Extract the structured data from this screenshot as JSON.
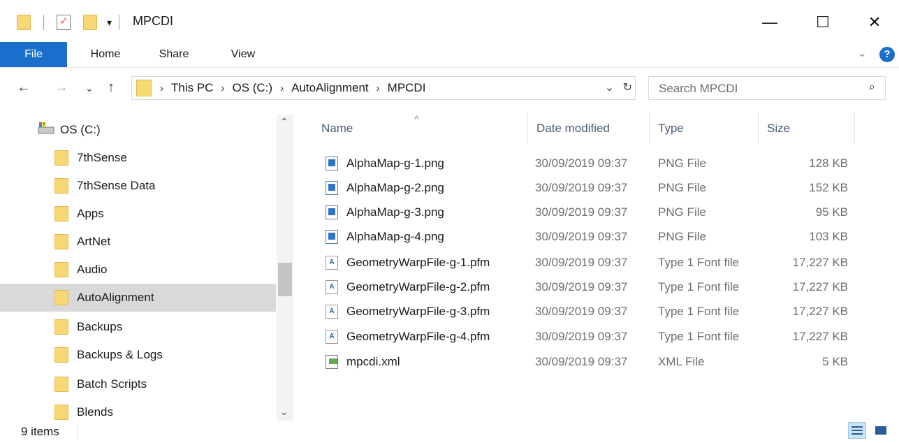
{
  "window": {
    "title": "MPCDI",
    "qa_dropdown_glyph": "▾",
    "minimize": "—",
    "maximize": "☐",
    "close": "✕"
  },
  "ribbon": {
    "tabs": [
      "File",
      "Home",
      "Share",
      "View"
    ],
    "expand_glyph": "⌄",
    "help_glyph": "?",
    "accent_color": "#1a6fcc"
  },
  "nav": {
    "back": "←",
    "forward": "→",
    "recent": "⌄",
    "up": "↑"
  },
  "address": {
    "crumbs": [
      "This PC",
      "OS (C:)",
      "AutoAlignment",
      "MPCDI"
    ],
    "separator": "›",
    "dropdown_glyph": "⌄",
    "refresh_glyph": "↻"
  },
  "search": {
    "placeholder": "Search MPCDI",
    "icon": "⌕"
  },
  "navpane": {
    "drive_label": "OS (C:)",
    "items": [
      {
        "label": "7thSense"
      },
      {
        "label": "7thSense Data"
      },
      {
        "label": "Apps"
      },
      {
        "label": "ArtNet"
      },
      {
        "label": "Audio"
      },
      {
        "label": "AutoAlignment",
        "selected": true
      },
      {
        "label": "Backups"
      },
      {
        "label": "Backups & Logs"
      },
      {
        "label": "Batch Scripts"
      },
      {
        "label": "Blends"
      }
    ],
    "scroll_up_glyph": "⌃",
    "scroll_down_glyph": "⌄"
  },
  "filelist": {
    "columns": [
      "Name",
      "Date modified",
      "Type",
      "Size"
    ],
    "sort_glyph": "^",
    "files": [
      {
        "name": "AlphaMap-g-1.png",
        "date": "30/09/2019 09:37",
        "type": "PNG File",
        "size": "128 KB",
        "icon": "png-file-icon"
      },
      {
        "name": "AlphaMap-g-2.png",
        "date": "30/09/2019 09:37",
        "type": "PNG File",
        "size": "152 KB",
        "icon": "png-file-icon"
      },
      {
        "name": "AlphaMap-g-3.png",
        "date": "30/09/2019 09:37",
        "type": "PNG File",
        "size": "95 KB",
        "icon": "png-file-icon"
      },
      {
        "name": "AlphaMap-g-4.png",
        "date": "30/09/2019 09:37",
        "type": "PNG File",
        "size": "103 KB",
        "icon": "png-file-icon"
      },
      {
        "name": "GeometryWarpFile-g-1.pfm",
        "date": "30/09/2019 09:37",
        "type": "Type 1 Font file",
        "size": "17,227 KB",
        "icon": "font-file-icon"
      },
      {
        "name": "GeometryWarpFile-g-2.pfm",
        "date": "30/09/2019 09:37",
        "type": "Type 1 Font file",
        "size": "17,227 KB",
        "icon": "font-file-icon"
      },
      {
        "name": "GeometryWarpFile-g-3.pfm",
        "date": "30/09/2019 09:37",
        "type": "Type 1 Font file",
        "size": "17,227 KB",
        "icon": "font-file-icon"
      },
      {
        "name": "GeometryWarpFile-g-4.pfm",
        "date": "30/09/2019 09:37",
        "type": "Type 1 Font file",
        "size": "17,227 KB",
        "icon": "font-file-icon"
      },
      {
        "name": "mpcdi.xml",
        "date": "30/09/2019 09:37",
        "type": "XML File",
        "size": "5 KB",
        "icon": "xml-file-icon"
      }
    ],
    "pfm_glyph": "A"
  },
  "status": {
    "item_count": "9 items"
  }
}
